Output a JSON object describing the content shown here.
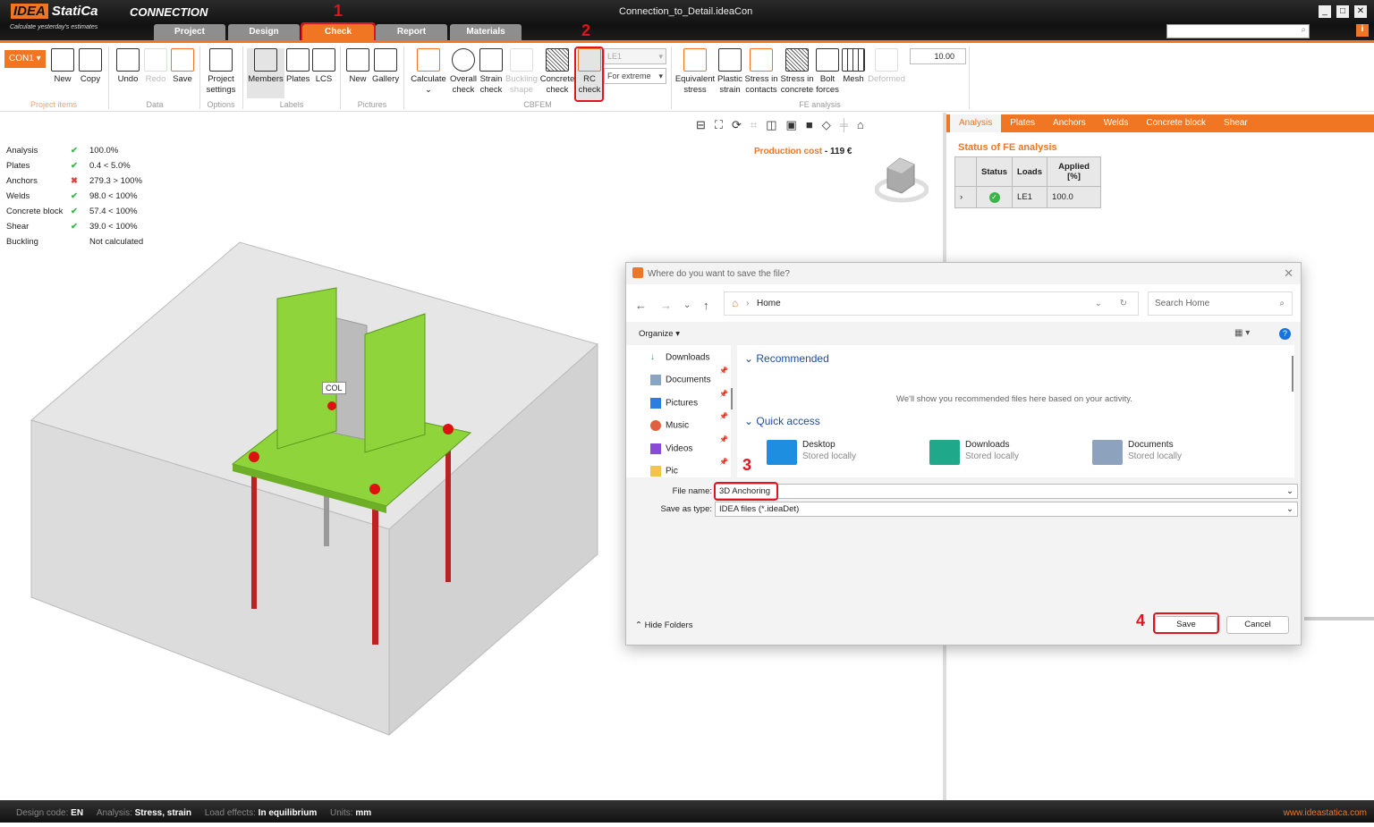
{
  "app": {
    "brand": "IDEA",
    "brand2": "StatiCa",
    "product": "CONNECTION",
    "slogan": "Calculate yesterday's estimates",
    "document_title": "Connection_to_Detail.ideaCon"
  },
  "main_tabs": [
    {
      "label": "Project"
    },
    {
      "label": "Design"
    },
    {
      "label": "Check"
    },
    {
      "label": "Report"
    },
    {
      "label": "Materials"
    }
  ],
  "annotations": [
    "1",
    "2",
    "3",
    "4"
  ],
  "ribbon": {
    "con_selector": "CON1",
    "project_items": {
      "new": "New",
      "copy": "Copy",
      "label": "Project items"
    },
    "data": {
      "undo": "Undo",
      "redo": "Redo",
      "save": "Save",
      "label": "Data"
    },
    "options": {
      "project_settings": "Project settings",
      "label": "Options"
    },
    "labels": {
      "members": "Members",
      "plates": "Plates",
      "lcs": "LCS",
      "label": "Labels"
    },
    "pictures": {
      "new": "New",
      "gallery": "Gallery",
      "label": "Pictures"
    },
    "cbfem": {
      "calculate": "Calculate",
      "overall_check": "Overall check",
      "strain_check": "Strain check",
      "buckling_shape": "Buckling shape",
      "concrete_check": "Concrete check",
      "rc_check": "RC check",
      "load_case": "LE1",
      "extreme": "For extreme",
      "label": "CBFEM"
    },
    "fe_analysis": {
      "equivalent_stress": "Equivalent stress",
      "plastic_strain": "Plastic strain",
      "stress_contacts": "Stress in contacts",
      "stress_concrete": "Stress in concrete",
      "bolt_forces": "Bolt forces",
      "mesh": "Mesh",
      "deformed": "Deformed",
      "scale_value": "10.00",
      "label": "FE analysis"
    }
  },
  "results": [
    {
      "label": "Analysis",
      "status": "ok",
      "value": "100.0%"
    },
    {
      "label": "Plates",
      "status": "ok",
      "value": "0.4 < 5.0%"
    },
    {
      "label": "Anchors",
      "status": "fail",
      "value": "279.3 > 100%"
    },
    {
      "label": "Welds",
      "status": "ok",
      "value": "98.0 < 100%"
    },
    {
      "label": "Concrete block",
      "status": "ok",
      "value": "57.4 < 100%"
    },
    {
      "label": "Shear",
      "status": "ok",
      "value": "39.0 < 100%"
    },
    {
      "label": "Buckling",
      "status": "none",
      "value": "Not calculated"
    }
  ],
  "viewport": {
    "production_cost_label": "Production cost",
    "production_cost_value": "119 €",
    "member_label": "COL"
  },
  "right_panel": {
    "tabs": [
      "Analysis",
      "Plates",
      "Anchors",
      "Welds",
      "Concrete block",
      "Shear"
    ],
    "title": "Status of FE analysis",
    "table": {
      "headers": [
        "Status",
        "Loads",
        "Applied [%]"
      ],
      "rows": [
        {
          "loads": "LE1",
          "applied": "100.0"
        }
      ]
    }
  },
  "dialog": {
    "title": "Where do you want to save the file?",
    "location": "Home",
    "search_placeholder": "Search Home",
    "organize": "Organize",
    "nav_items": [
      "Downloads",
      "Documents",
      "Pictures",
      "Music",
      "Videos",
      "Pic"
    ],
    "recommended": "Recommended",
    "recommended_empty": "We'll show you recommended files here based on your activity.",
    "quick_access": "Quick access",
    "quick_items": [
      {
        "name": "Desktop",
        "sub": "Stored locally"
      },
      {
        "name": "Downloads",
        "sub": "Stored locally"
      },
      {
        "name": "Documents",
        "sub": "Stored locally"
      }
    ],
    "file_name_label": "File name:",
    "file_name": "3D Anchoring",
    "save_type_label": "Save as type:",
    "save_type": "IDEA files (*.ideaDet)",
    "hide_folders": "Hide Folders",
    "save": "Save",
    "cancel": "Cancel"
  },
  "status_bar": {
    "design_code_label": "Design code:",
    "design_code": "EN",
    "analysis_label": "Analysis:",
    "analysis": "Stress, strain",
    "load_effects_label": "Load effects:",
    "load_effects": "In equilibrium",
    "units_label": "Units:",
    "units": "mm",
    "website": "www.ideastatica.com"
  }
}
